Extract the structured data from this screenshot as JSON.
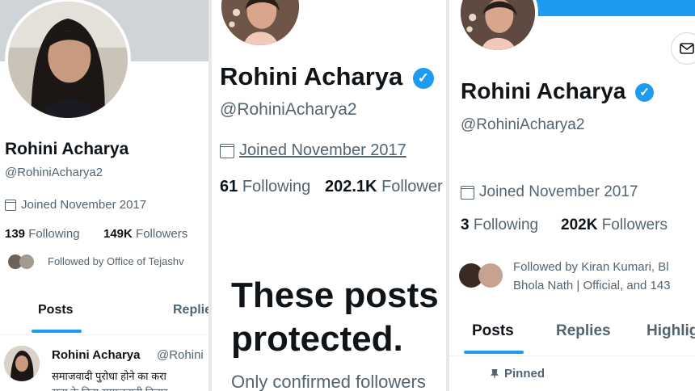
{
  "panel1": {
    "name": "Rohini Acharya",
    "handle": "@RohiniAcharya2",
    "joined": "Joined November 2017",
    "following_count": "139",
    "following_label": "Following",
    "followers_count": "149K",
    "followers_label": "Followers",
    "followed_by": "Followed by Office of Tejashv",
    "tabs": [
      "Posts",
      "Replie"
    ],
    "tweet_name": "Rohini Acharya",
    "tweet_handle": "@Rohini",
    "tweet_line1": "समाजवादी पुरोधा होने का करा",
    "tweet_line2": "सता के बिना समाजवादी विचार"
  },
  "panel2": {
    "name": "Rohini Acharya",
    "handle": "@RohiniAcharya2",
    "joined": "Joined November 2017",
    "following_count": "61",
    "following_label": "Following",
    "followers_count": "202.1K",
    "followers_label": "Follower",
    "protected_line1": "These posts",
    "protected_line2": "protected.",
    "protected_sub": "Only confirmed followers"
  },
  "panel3": {
    "name": "Rohini Acharya",
    "handle": "@RohiniAcharya2",
    "joined": "Joined November 2017",
    "following_count": "3",
    "following_label": "Following",
    "followers_count": "202K",
    "followers_label": "Followers",
    "followed_by_line1": "Followed by Kiran Kumari, Bl",
    "followed_by_line2": "Bhola Nath | Official, and 143",
    "tabs": [
      "Posts",
      "Replies",
      "Highlig"
    ],
    "pinned": "Pinned"
  },
  "colors": {
    "accent": "#1d9bf0",
    "text": "#0f1419",
    "muted": "#536471"
  }
}
